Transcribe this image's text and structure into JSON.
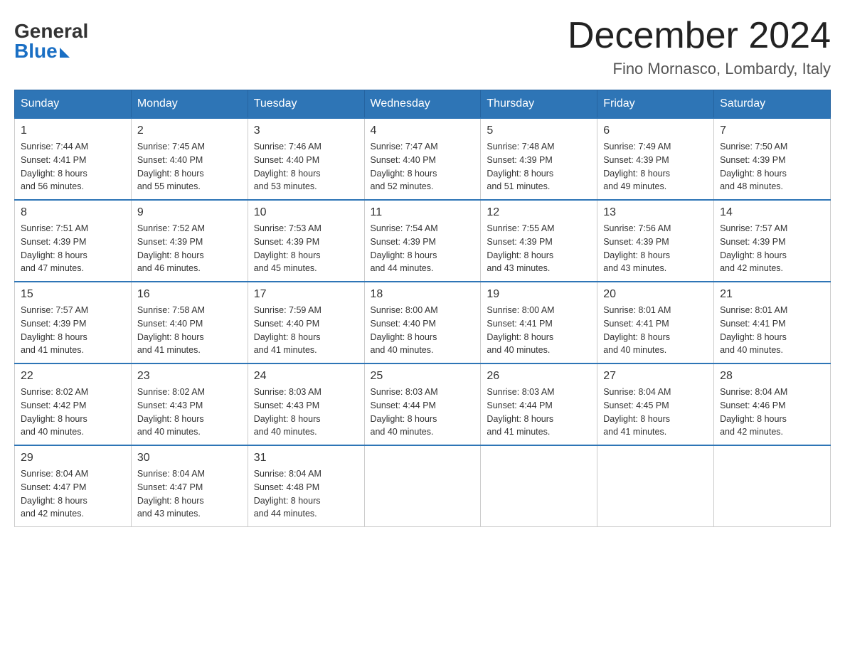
{
  "header": {
    "logo_general": "General",
    "logo_blue": "Blue",
    "month_title": "December 2024",
    "location": "Fino Mornasco, Lombardy, Italy"
  },
  "days_of_week": [
    "Sunday",
    "Monday",
    "Tuesday",
    "Wednesday",
    "Thursday",
    "Friday",
    "Saturday"
  ],
  "weeks": [
    [
      {
        "day": "1",
        "sunrise": "7:44 AM",
        "sunset": "4:41 PM",
        "daylight": "8 hours and 56 minutes."
      },
      {
        "day": "2",
        "sunrise": "7:45 AM",
        "sunset": "4:40 PM",
        "daylight": "8 hours and 55 minutes."
      },
      {
        "day": "3",
        "sunrise": "7:46 AM",
        "sunset": "4:40 PM",
        "daylight": "8 hours and 53 minutes."
      },
      {
        "day": "4",
        "sunrise": "7:47 AM",
        "sunset": "4:40 PM",
        "daylight": "8 hours and 52 minutes."
      },
      {
        "day": "5",
        "sunrise": "7:48 AM",
        "sunset": "4:39 PM",
        "daylight": "8 hours and 51 minutes."
      },
      {
        "day": "6",
        "sunrise": "7:49 AM",
        "sunset": "4:39 PM",
        "daylight": "8 hours and 49 minutes."
      },
      {
        "day": "7",
        "sunrise": "7:50 AM",
        "sunset": "4:39 PM",
        "daylight": "8 hours and 48 minutes."
      }
    ],
    [
      {
        "day": "8",
        "sunrise": "7:51 AM",
        "sunset": "4:39 PM",
        "daylight": "8 hours and 47 minutes."
      },
      {
        "day": "9",
        "sunrise": "7:52 AM",
        "sunset": "4:39 PM",
        "daylight": "8 hours and 46 minutes."
      },
      {
        "day": "10",
        "sunrise": "7:53 AM",
        "sunset": "4:39 PM",
        "daylight": "8 hours and 45 minutes."
      },
      {
        "day": "11",
        "sunrise": "7:54 AM",
        "sunset": "4:39 PM",
        "daylight": "8 hours and 44 minutes."
      },
      {
        "day": "12",
        "sunrise": "7:55 AM",
        "sunset": "4:39 PM",
        "daylight": "8 hours and 43 minutes."
      },
      {
        "day": "13",
        "sunrise": "7:56 AM",
        "sunset": "4:39 PM",
        "daylight": "8 hours and 43 minutes."
      },
      {
        "day": "14",
        "sunrise": "7:57 AM",
        "sunset": "4:39 PM",
        "daylight": "8 hours and 42 minutes."
      }
    ],
    [
      {
        "day": "15",
        "sunrise": "7:57 AM",
        "sunset": "4:39 PM",
        "daylight": "8 hours and 41 minutes."
      },
      {
        "day": "16",
        "sunrise": "7:58 AM",
        "sunset": "4:40 PM",
        "daylight": "8 hours and 41 minutes."
      },
      {
        "day": "17",
        "sunrise": "7:59 AM",
        "sunset": "4:40 PM",
        "daylight": "8 hours and 41 minutes."
      },
      {
        "day": "18",
        "sunrise": "8:00 AM",
        "sunset": "4:40 PM",
        "daylight": "8 hours and 40 minutes."
      },
      {
        "day": "19",
        "sunrise": "8:00 AM",
        "sunset": "4:41 PM",
        "daylight": "8 hours and 40 minutes."
      },
      {
        "day": "20",
        "sunrise": "8:01 AM",
        "sunset": "4:41 PM",
        "daylight": "8 hours and 40 minutes."
      },
      {
        "day": "21",
        "sunrise": "8:01 AM",
        "sunset": "4:41 PM",
        "daylight": "8 hours and 40 minutes."
      }
    ],
    [
      {
        "day": "22",
        "sunrise": "8:02 AM",
        "sunset": "4:42 PM",
        "daylight": "8 hours and 40 minutes."
      },
      {
        "day": "23",
        "sunrise": "8:02 AM",
        "sunset": "4:43 PM",
        "daylight": "8 hours and 40 minutes."
      },
      {
        "day": "24",
        "sunrise": "8:03 AM",
        "sunset": "4:43 PM",
        "daylight": "8 hours and 40 minutes."
      },
      {
        "day": "25",
        "sunrise": "8:03 AM",
        "sunset": "4:44 PM",
        "daylight": "8 hours and 40 minutes."
      },
      {
        "day": "26",
        "sunrise": "8:03 AM",
        "sunset": "4:44 PM",
        "daylight": "8 hours and 41 minutes."
      },
      {
        "day": "27",
        "sunrise": "8:04 AM",
        "sunset": "4:45 PM",
        "daylight": "8 hours and 41 minutes."
      },
      {
        "day": "28",
        "sunrise": "8:04 AM",
        "sunset": "4:46 PM",
        "daylight": "8 hours and 42 minutes."
      }
    ],
    [
      {
        "day": "29",
        "sunrise": "8:04 AM",
        "sunset": "4:47 PM",
        "daylight": "8 hours and 42 minutes."
      },
      {
        "day": "30",
        "sunrise": "8:04 AM",
        "sunset": "4:47 PM",
        "daylight": "8 hours and 43 minutes."
      },
      {
        "day": "31",
        "sunrise": "8:04 AM",
        "sunset": "4:48 PM",
        "daylight": "8 hours and 44 minutes."
      },
      null,
      null,
      null,
      null
    ]
  ],
  "labels": {
    "sunrise_prefix": "Sunrise: ",
    "sunset_prefix": "Sunset: ",
    "daylight_prefix": "Daylight: "
  }
}
